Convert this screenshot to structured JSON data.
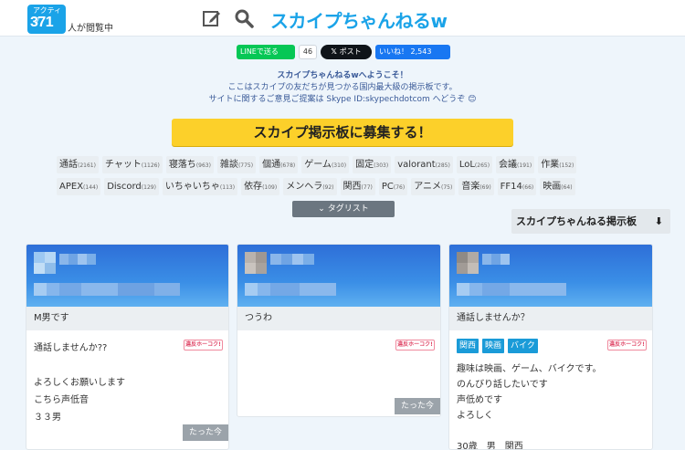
{
  "header": {
    "active_label": "アクティブ",
    "active_count": "371",
    "active_suffix": "人が閲覧中",
    "site_title": "スカイプちゃんねるw"
  },
  "social": {
    "line": "LINEで送る",
    "line_count": "46",
    "x": "ポスト",
    "fb": "いいね！ 2,543"
  },
  "welcome": {
    "line1": "スカイプちゃんねるwへようこそ！",
    "line2": "ここはスカイプの友だちが見つかる国内最大級の掲示板です。",
    "line3": "サイトに関するご意見ご提案は Skype ID:skypechdotcom へどうぞ 😊"
  },
  "recruit_button": "スカイプ掲示板に募集する！",
  "tags_row1": [
    {
      "name": "通話",
      "count": "(2161)"
    },
    {
      "name": "チャット",
      "count": "(1126)"
    },
    {
      "name": "寝落ち",
      "count": "(963)"
    },
    {
      "name": "雑談",
      "count": "(775)"
    },
    {
      "name": "個通",
      "count": "(678)"
    },
    {
      "name": "ゲーム",
      "count": "(310)"
    },
    {
      "name": "固定",
      "count": "(303)"
    },
    {
      "name": "valorant",
      "count": "(285)"
    },
    {
      "name": "LoL",
      "count": "(265)"
    },
    {
      "name": "会議",
      "count": "(191)"
    },
    {
      "name": "作業",
      "count": "(152)"
    }
  ],
  "tags_row2": [
    {
      "name": "APEX",
      "count": "(144)"
    },
    {
      "name": "Discord",
      "count": "(129)"
    },
    {
      "name": "いちゃいちゃ",
      "count": "(113)"
    },
    {
      "name": "依存",
      "count": "(109)"
    },
    {
      "name": "メンヘラ",
      "count": "(92)"
    },
    {
      "name": "関西",
      "count": "(77)"
    },
    {
      "name": "PC",
      "count": "(76)"
    },
    {
      "name": "アニメ",
      "count": "(75)"
    },
    {
      "name": "音楽",
      "count": "(69)"
    },
    {
      "name": "FF14",
      "count": "(66)"
    },
    {
      "name": "映画",
      "count": "(64)"
    }
  ],
  "taglist_button": "タグリスト",
  "board_link": "スカイプちゃんねる掲示板",
  "cards": [
    {
      "title": "M男です",
      "report": "違反ホーコク!",
      "lines": [
        "通話しませんか??",
        "",
        "よろしくお願いします",
        "こちら声低音",
        "３３男"
      ],
      "time": "たった今"
    },
    {
      "title": "つうわ",
      "report": "違反ホーコク!",
      "lines": [],
      "time": "たった今"
    },
    {
      "title": "通話しませんか？",
      "report": "違反ホーコク!",
      "tags": [
        "関西",
        "映画",
        "バイク"
      ],
      "lines": [
        "趣味は映画、ゲーム、バイクです。",
        "のんびり話したいです",
        "声低めです",
        "よろしく",
        "",
        "30歳　男　関西"
      ]
    }
  ],
  "colors": {
    "accent": "#1aa3e8",
    "recruit": "#fcd02a",
    "line": "#06c755",
    "fb": "#1877f2",
    "tag_blue": "#1a9bd8"
  }
}
